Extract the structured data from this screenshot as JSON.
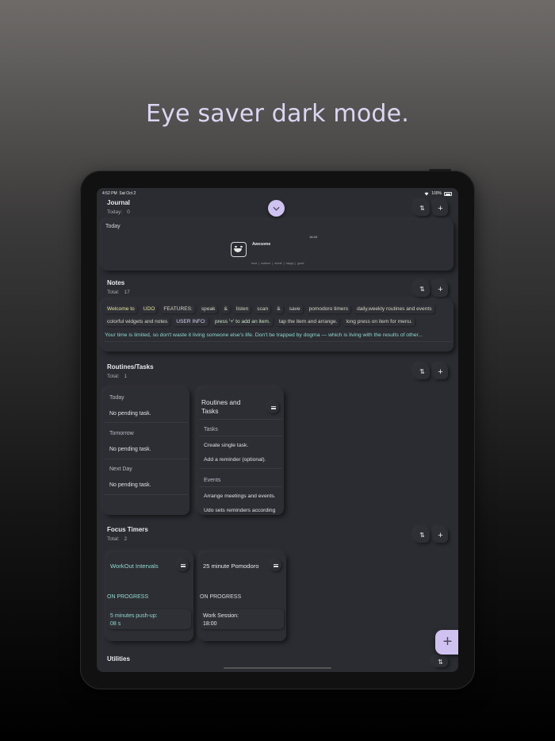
{
  "headline": "Eye saver dark mode.",
  "status_bar": {
    "time": "4:52 PM",
    "date": "Sat Oct 2",
    "wifi": "wifi-icon",
    "battery": "100%"
  },
  "journal": {
    "title": "Journal",
    "sub_label": "Today:",
    "count": "0",
    "card": {
      "heading": "Today",
      "time": "16:43",
      "mood": "Awesome",
      "tags": [
        "food",
        "outdoor",
        "movie",
        "happy",
        "good"
      ]
    }
  },
  "notes": {
    "title": "Notes",
    "sub_label": "Total:",
    "count": "17",
    "row1": [
      "Welcome to",
      "UDO",
      "FEATURES:",
      "speak",
      "&",
      "listen",
      "scan",
      "&",
      "save",
      "pomodoro timers",
      "daily,weekly routines and events"
    ],
    "row2": [
      "colorful widgets and notes",
      "USER INFO:",
      "press '+' to add an item.",
      "tap the item and arrange.",
      "long press on item for menu."
    ],
    "quote": "Your time is limited, so don't waste it living someone else's life. Don't be trapped by dogma — which is living with the results of other..."
  },
  "routines": {
    "title": "Routines/Tasks",
    "sub_label": "Total:",
    "count": "1",
    "days": [
      {
        "label": "Today",
        "text": "No pending task."
      },
      {
        "label": "Tomorrow",
        "text": "No pending task."
      },
      {
        "label": "Next Day",
        "text": "No pending task."
      }
    ],
    "card2": {
      "title": "Routines and Tasks",
      "tasks_label": "Tasks",
      "task1": "Create single task.",
      "task2": "Add a reminder (optional).",
      "events_label": "Events",
      "event1": "Arrange meetings and events.",
      "event2": "Udo sets reminders according"
    }
  },
  "focus_timers": {
    "title": "Focus Timers",
    "sub_label": "Total:",
    "count": "2",
    "timers": [
      {
        "title": "WorkOut Intervals",
        "status": "ON PROGRESS",
        "line1": "5 minutes push-up:",
        "line2": "08 s",
        "color": "#8fd9d0"
      },
      {
        "title": "25 minute Pomodoro",
        "status": "ON PROGRESS",
        "line1": "Work Session:",
        "line2": "18:00",
        "color": "#e5e5ea"
      }
    ]
  },
  "utilities": {
    "title": "Utilities"
  },
  "fab": "+",
  "colors": {
    "accent": "#cfc2f0",
    "background": "#2b2c31",
    "teal_text": "#8fd9d0"
  }
}
